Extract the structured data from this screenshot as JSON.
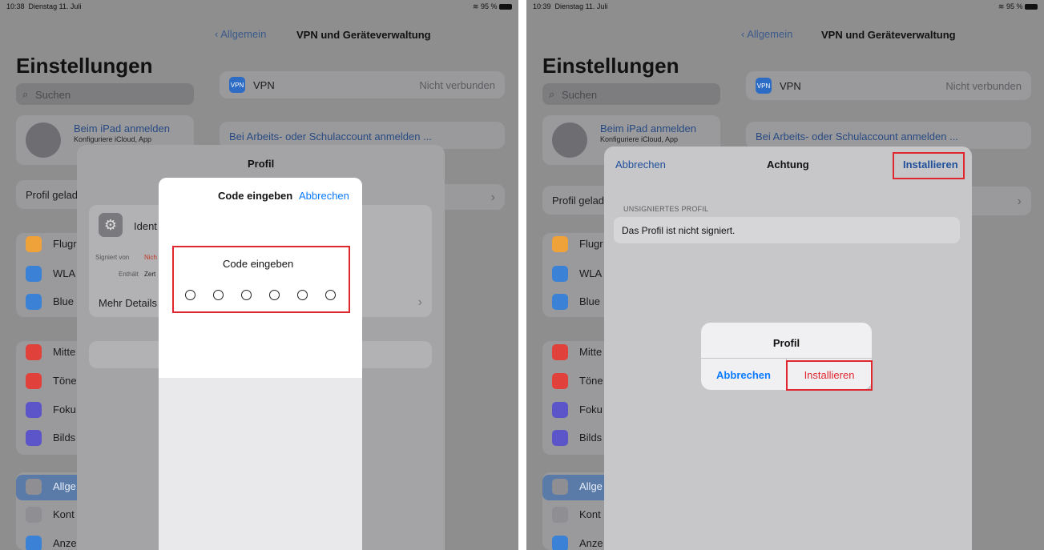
{
  "left": {
    "status": {
      "time": "10:38",
      "date": "Dienstag 11. Juli",
      "battery": "95 %"
    },
    "nav": {
      "back_label": "Allgemein",
      "title": "VPN und Geräteverwaltung"
    },
    "settings_title": "Einstellungen",
    "search_placeholder": "Suchen",
    "account": {
      "title": "Beim iPad anmelden",
      "subtitle": "Konfiguriere iCloud, App"
    },
    "profile_loaded": "Profil gelad",
    "sidebar": [
      {
        "label": "Flugr",
        "icon": "airplane-icon",
        "color": "#f0a23a"
      },
      {
        "label": "WLA",
        "icon": "wifi-icon",
        "color": "#3b82d6"
      },
      {
        "label": "Blue",
        "icon": "bluetooth-icon",
        "color": "#3b82d6"
      },
      {
        "label": "Mitte",
        "icon": "notifications-icon",
        "color": "#e0413a"
      },
      {
        "label": "Töne",
        "icon": "sounds-icon",
        "color": "#e0413a"
      },
      {
        "label": "Foku",
        "icon": "focus-moon-icon",
        "color": "#5b55c9"
      },
      {
        "label": "Bilds",
        "icon": "screentime-hourglass-icon",
        "color": "#5b55c9"
      },
      {
        "label": "Allge",
        "icon": "general-gear-icon",
        "color": "#8e8e93"
      },
      {
        "label": "Kont",
        "icon": "control-center-icon",
        "color": "#8e8e93"
      },
      {
        "label": "Anze",
        "icon": "display-aa-icon",
        "color": "#3b82d6"
      }
    ],
    "vpn": {
      "label": "VPN",
      "icon_text": "VPN",
      "status": "Nicht verbunden"
    },
    "work_account": "Bei Arbeits- oder Schulaccount anmelden ...",
    "profil_sheet": {
      "title": "Profil",
      "identity": "Ident",
      "signed_by_label": "Signiert von",
      "signed_by_value": "Nich",
      "contains_label": "Enthält",
      "contains_value": "Zert",
      "more_details": "Mehr Details"
    },
    "code_dialog": {
      "title": "Code eingeben",
      "cancel": "Abbrechen",
      "prompt": "Code eingeben"
    }
  },
  "right": {
    "status": {
      "time": "10:39",
      "date": "Dienstag 11. Juli",
      "battery": "95 %"
    },
    "nav": {
      "back_label": "Allgemein",
      "title": "VPN und Geräteverwaltung"
    },
    "settings_title": "Einstellungen",
    "search_placeholder": "Suchen",
    "account": {
      "title": "Beim iPad anmelden",
      "subtitle": "Konfiguriere iCloud, App"
    },
    "profile_loaded": "Profil gelad",
    "sidebar": [
      {
        "label": "Flugr",
        "icon": "airplane-icon",
        "color": "#f0a23a"
      },
      {
        "label": "WLA",
        "icon": "wifi-icon",
        "color": "#3b82d6"
      },
      {
        "label": "Blue",
        "icon": "bluetooth-icon",
        "color": "#3b82d6"
      },
      {
        "label": "Mitte",
        "icon": "notifications-icon",
        "color": "#e0413a"
      },
      {
        "label": "Töne",
        "icon": "sounds-icon",
        "color": "#e0413a"
      },
      {
        "label": "Foku",
        "icon": "focus-moon-icon",
        "color": "#5b55c9"
      },
      {
        "label": "Bilds",
        "icon": "screentime-hourglass-icon",
        "color": "#5b55c9"
      },
      {
        "label": "Allge",
        "icon": "general-gear-icon",
        "color": "#8e8e93"
      },
      {
        "label": "Kont",
        "icon": "control-center-icon",
        "color": "#8e8e93"
      },
      {
        "label": "Anze",
        "icon": "display-aa-icon",
        "color": "#3b82d6"
      }
    ],
    "vpn": {
      "label": "VPN",
      "icon_text": "VPN",
      "status": "Nicht verbunden"
    },
    "work_account": "Bei Arbeits- oder Schulaccount anmelden ...",
    "warning_sheet": {
      "cancel": "Abbrechen",
      "title": "Achtung",
      "install": "Installieren",
      "section_header": "UNSIGNIERTES PROFIL",
      "message": "Das Profil ist nicht signiert."
    },
    "alert": {
      "title": "Profil",
      "cancel": "Abbrechen",
      "install": "Installieren"
    }
  },
  "colors": {
    "accent": "#0a7aff",
    "destructive": "#e0262f",
    "highlight_box": "#e0262f"
  }
}
